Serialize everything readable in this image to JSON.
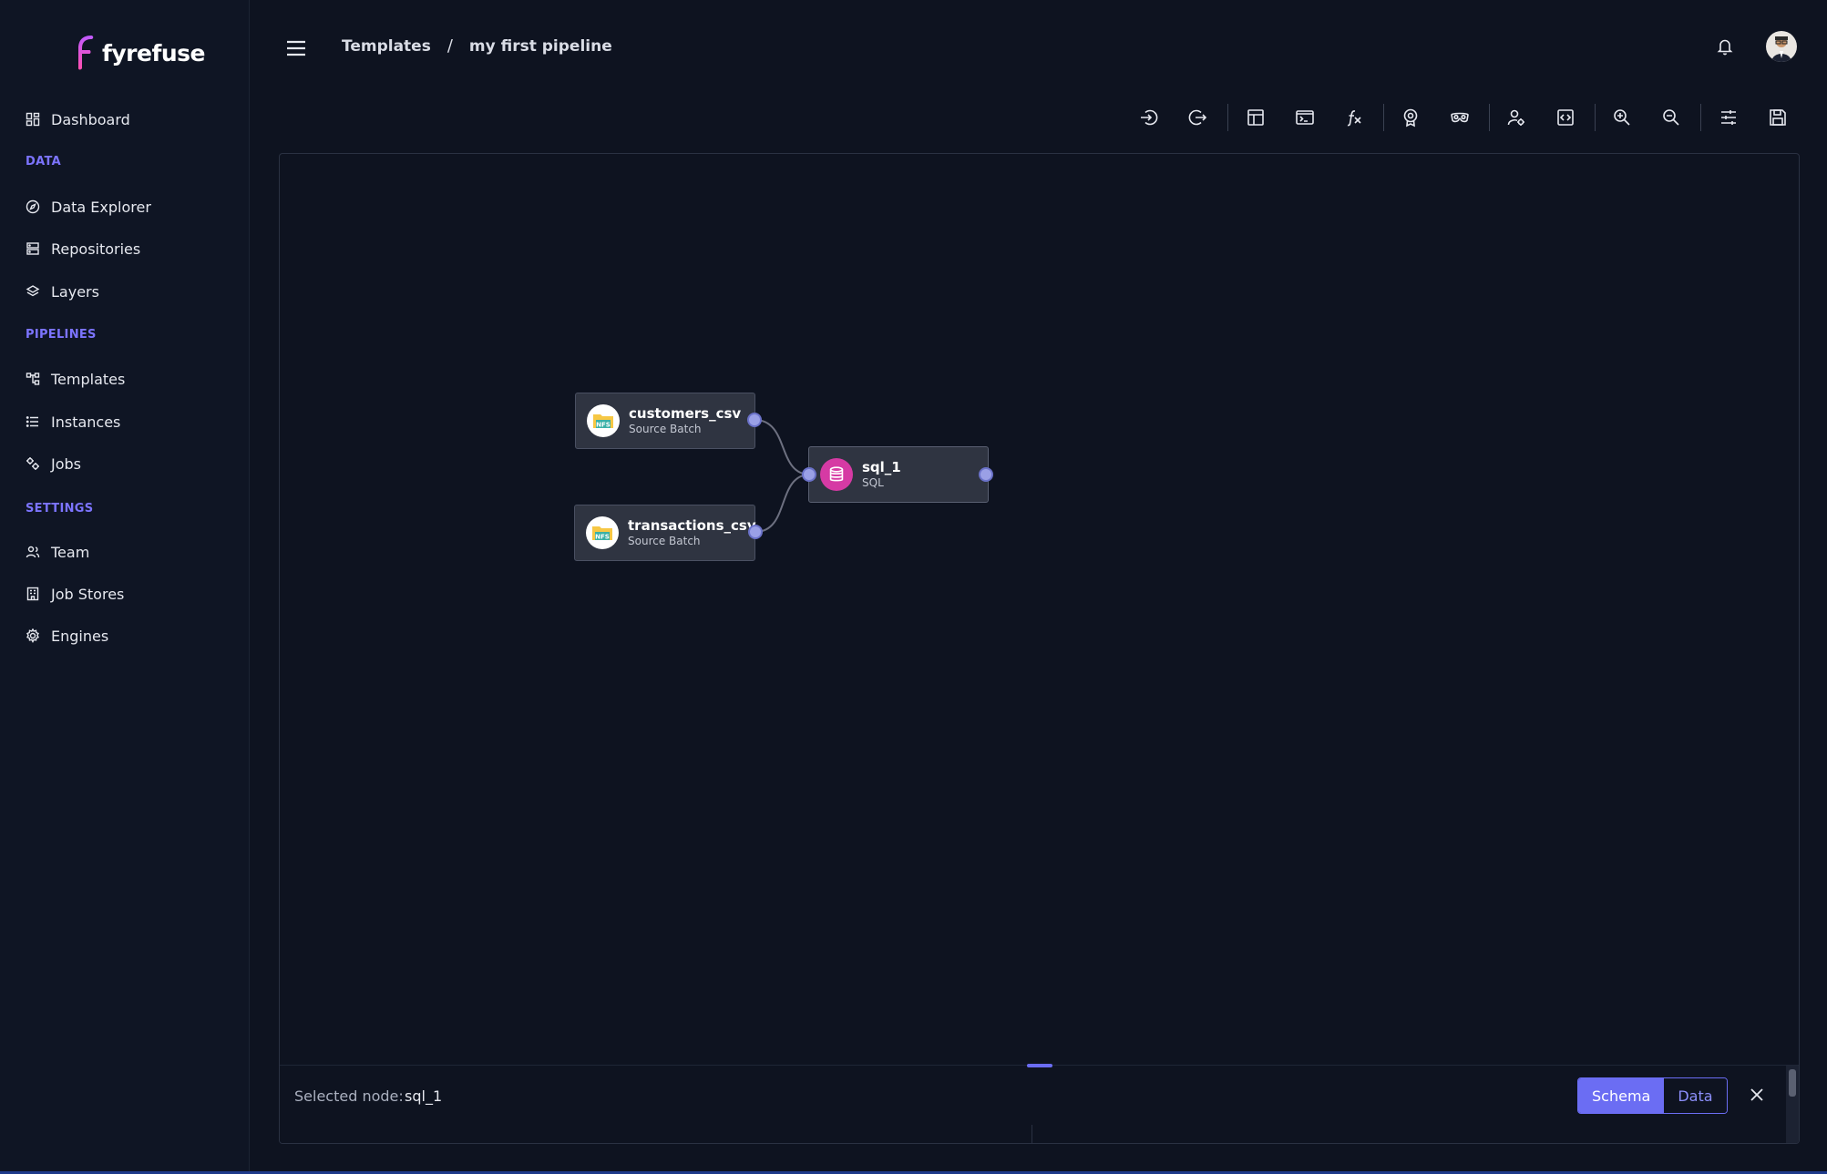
{
  "app": {
    "logo_text": "fyrefuse"
  },
  "sidebar": {
    "top_item": {
      "label": "Dashboard",
      "icon": "dashboard-icon"
    },
    "sections": [
      {
        "title": "DATA",
        "items": [
          {
            "label": "Data Explorer",
            "icon": "compass-icon"
          },
          {
            "label": "Repositories",
            "icon": "server-icon"
          },
          {
            "label": "Layers",
            "icon": "layers-icon"
          }
        ]
      },
      {
        "title": "PIPELINES",
        "items": [
          {
            "label": "Templates",
            "icon": "flow-icon"
          },
          {
            "label": "Instances",
            "icon": "list-icon"
          },
          {
            "label": "Jobs",
            "icon": "cogs-icon"
          }
        ]
      },
      {
        "title": "SETTINGS",
        "items": [
          {
            "label": "Team",
            "icon": "users-icon"
          },
          {
            "label": "Job Stores",
            "icon": "building-icon"
          },
          {
            "label": "Engines",
            "icon": "gear-icon"
          }
        ]
      }
    ]
  },
  "header": {
    "breadcrumb": [
      "Templates",
      "my first pipeline"
    ],
    "separator": "/"
  },
  "toolbar": {
    "icons": [
      "login-icon",
      "logout-icon",
      "table-icon",
      "terminal-icon",
      "function-icon",
      "badge-icon",
      "mask-icon",
      "user-settings-icon",
      "code-icon",
      "zoom-in-icon",
      "zoom-out-icon",
      "sliders-icon",
      "save-icon"
    ]
  },
  "canvas": {
    "nodes": [
      {
        "title": "customers_csv",
        "subtitle": "Source Batch",
        "icon_label": "NFS"
      },
      {
        "title": "transactions_csv",
        "subtitle": "Source Batch",
        "icon_label": "NFS"
      },
      {
        "title": "sql_1",
        "subtitle": "SQL"
      }
    ]
  },
  "panel": {
    "selected_label": "Selected node:",
    "selected_value": "sql_1",
    "tabs": [
      "Schema",
      "Data"
    ],
    "active_tab": "Schema"
  },
  "colors": {
    "accent": "#6b6df3",
    "background": "#0e1320",
    "node": "#2f3441",
    "sql_icon": "#d63aa4"
  }
}
